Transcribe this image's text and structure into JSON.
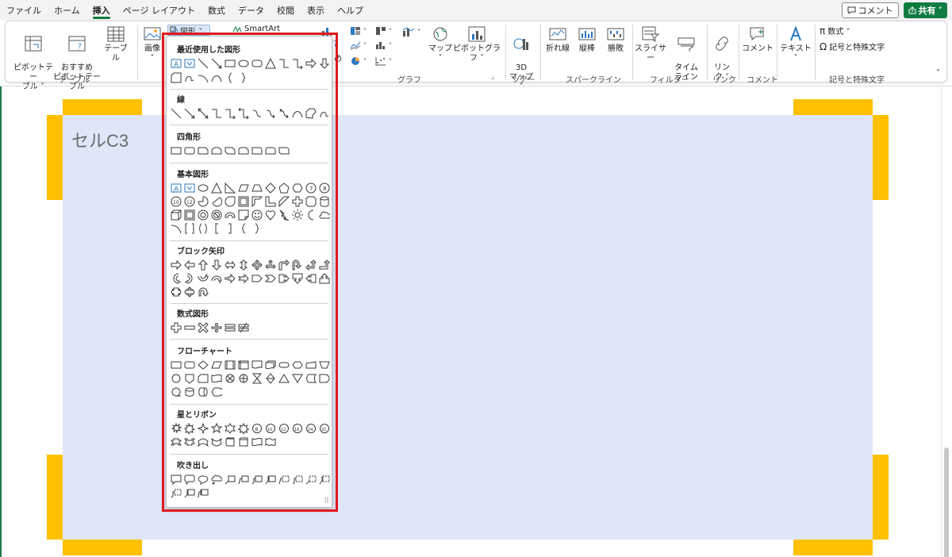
{
  "menu": {
    "tabs": [
      "ファイル",
      "ホーム",
      "挿入",
      "ページ レイアウト",
      "数式",
      "データ",
      "校閲",
      "表示",
      "ヘルプ"
    ],
    "active_index": 2,
    "comment_label": "コメント",
    "share_label": "共有",
    "share_caret": "˅"
  },
  "ribbon": {
    "pivot_table": "ピボットテー\nブル ˅",
    "recommended_pivot": "おすすめ\nピボットテーブル",
    "table": "テーブル",
    "group_table": "テーブル",
    "image": "画像",
    "image_caret": "˅",
    "shapes": "図形 ˅",
    "smartart": "SmartArt",
    "partial_label": "め",
    "map": "マップ ˅",
    "pivot_chart": "ピボットグラフ ˅",
    "group_chart": "グラフ",
    "map3d": "3D\nマップ ˅",
    "group_tour": "ツアー",
    "line": "折れ線",
    "column": "縦棒",
    "winloss": "勝敗",
    "group_sparkline": "スパークライン",
    "slicer": "スライサー",
    "timeline": "タイム\nライン",
    "group_filter": "フィルター",
    "link": "リン\nク ˅",
    "group_link": "リンク",
    "comment": "コメント",
    "group_comment": "コメント",
    "text": "テキスト ˅",
    "equation": "数式 ˅",
    "symbol": "記号と特殊文字",
    "group_symbol": "記号と特殊文字",
    "pi_glyph": "π",
    "omega_glyph": "Ω",
    "collapse_glyph": "˅",
    "launcher_glyph": "⌟"
  },
  "sheet": {
    "cell_label": "セルC3"
  },
  "dropdown": {
    "sections": [
      {
        "title": "最近使用した図形"
      },
      {
        "title": "線"
      },
      {
        "title": "四角形"
      },
      {
        "title": "基本図形"
      },
      {
        "title": "ブロック矢印"
      },
      {
        "title": "数式図形"
      },
      {
        "title": "フローチャート"
      },
      {
        "title": "星とリボン"
      },
      {
        "title": "吹き出し"
      }
    ],
    "grip": "⠿",
    "textbox_glyph": "A"
  },
  "colors": {
    "accent_green": "#107c41",
    "highlight_red": "#e0191e",
    "orange": "#ffc000",
    "cell_fill": "#dfe6f8"
  }
}
